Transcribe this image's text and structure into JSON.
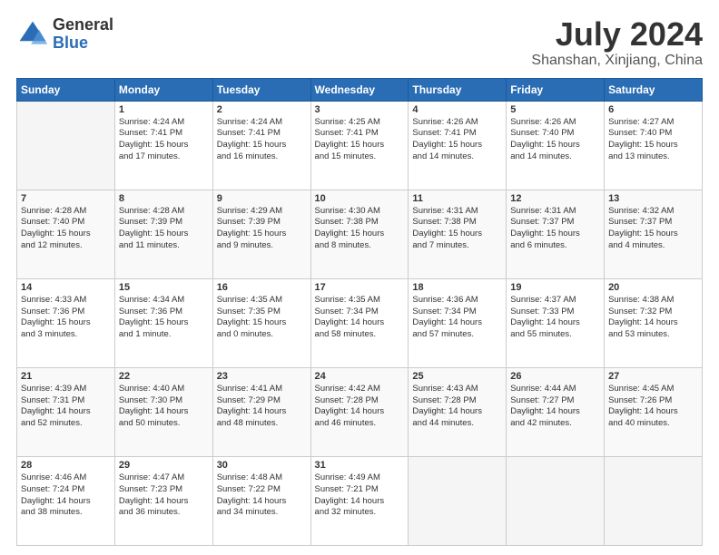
{
  "header": {
    "logo_general": "General",
    "logo_blue": "Blue",
    "title": "July 2024",
    "subtitle": "Shanshan, Xinjiang, China"
  },
  "days_of_week": [
    "Sunday",
    "Monday",
    "Tuesday",
    "Wednesday",
    "Thursday",
    "Friday",
    "Saturday"
  ],
  "weeks": [
    [
      {
        "day": "",
        "info": ""
      },
      {
        "day": "1",
        "info": "Sunrise: 4:24 AM\nSunset: 7:41 PM\nDaylight: 15 hours\nand 17 minutes."
      },
      {
        "day": "2",
        "info": "Sunrise: 4:24 AM\nSunset: 7:41 PM\nDaylight: 15 hours\nand 16 minutes."
      },
      {
        "day": "3",
        "info": "Sunrise: 4:25 AM\nSunset: 7:41 PM\nDaylight: 15 hours\nand 15 minutes."
      },
      {
        "day": "4",
        "info": "Sunrise: 4:26 AM\nSunset: 7:41 PM\nDaylight: 15 hours\nand 14 minutes."
      },
      {
        "day": "5",
        "info": "Sunrise: 4:26 AM\nSunset: 7:40 PM\nDaylight: 15 hours\nand 14 minutes."
      },
      {
        "day": "6",
        "info": "Sunrise: 4:27 AM\nSunset: 7:40 PM\nDaylight: 15 hours\nand 13 minutes."
      }
    ],
    [
      {
        "day": "7",
        "info": "Sunrise: 4:28 AM\nSunset: 7:40 PM\nDaylight: 15 hours\nand 12 minutes."
      },
      {
        "day": "8",
        "info": "Sunrise: 4:28 AM\nSunset: 7:39 PM\nDaylight: 15 hours\nand 11 minutes."
      },
      {
        "day": "9",
        "info": "Sunrise: 4:29 AM\nSunset: 7:39 PM\nDaylight: 15 hours\nand 9 minutes."
      },
      {
        "day": "10",
        "info": "Sunrise: 4:30 AM\nSunset: 7:38 PM\nDaylight: 15 hours\nand 8 minutes."
      },
      {
        "day": "11",
        "info": "Sunrise: 4:31 AM\nSunset: 7:38 PM\nDaylight: 15 hours\nand 7 minutes."
      },
      {
        "day": "12",
        "info": "Sunrise: 4:31 AM\nSunset: 7:37 PM\nDaylight: 15 hours\nand 6 minutes."
      },
      {
        "day": "13",
        "info": "Sunrise: 4:32 AM\nSunset: 7:37 PM\nDaylight: 15 hours\nand 4 minutes."
      }
    ],
    [
      {
        "day": "14",
        "info": "Sunrise: 4:33 AM\nSunset: 7:36 PM\nDaylight: 15 hours\nand 3 minutes."
      },
      {
        "day": "15",
        "info": "Sunrise: 4:34 AM\nSunset: 7:36 PM\nDaylight: 15 hours\nand 1 minute."
      },
      {
        "day": "16",
        "info": "Sunrise: 4:35 AM\nSunset: 7:35 PM\nDaylight: 15 hours\nand 0 minutes."
      },
      {
        "day": "17",
        "info": "Sunrise: 4:35 AM\nSunset: 7:34 PM\nDaylight: 14 hours\nand 58 minutes."
      },
      {
        "day": "18",
        "info": "Sunrise: 4:36 AM\nSunset: 7:34 PM\nDaylight: 14 hours\nand 57 minutes."
      },
      {
        "day": "19",
        "info": "Sunrise: 4:37 AM\nSunset: 7:33 PM\nDaylight: 14 hours\nand 55 minutes."
      },
      {
        "day": "20",
        "info": "Sunrise: 4:38 AM\nSunset: 7:32 PM\nDaylight: 14 hours\nand 53 minutes."
      }
    ],
    [
      {
        "day": "21",
        "info": "Sunrise: 4:39 AM\nSunset: 7:31 PM\nDaylight: 14 hours\nand 52 minutes."
      },
      {
        "day": "22",
        "info": "Sunrise: 4:40 AM\nSunset: 7:30 PM\nDaylight: 14 hours\nand 50 minutes."
      },
      {
        "day": "23",
        "info": "Sunrise: 4:41 AM\nSunset: 7:29 PM\nDaylight: 14 hours\nand 48 minutes."
      },
      {
        "day": "24",
        "info": "Sunrise: 4:42 AM\nSunset: 7:28 PM\nDaylight: 14 hours\nand 46 minutes."
      },
      {
        "day": "25",
        "info": "Sunrise: 4:43 AM\nSunset: 7:28 PM\nDaylight: 14 hours\nand 44 minutes."
      },
      {
        "day": "26",
        "info": "Sunrise: 4:44 AM\nSunset: 7:27 PM\nDaylight: 14 hours\nand 42 minutes."
      },
      {
        "day": "27",
        "info": "Sunrise: 4:45 AM\nSunset: 7:26 PM\nDaylight: 14 hours\nand 40 minutes."
      }
    ],
    [
      {
        "day": "28",
        "info": "Sunrise: 4:46 AM\nSunset: 7:24 PM\nDaylight: 14 hours\nand 38 minutes."
      },
      {
        "day": "29",
        "info": "Sunrise: 4:47 AM\nSunset: 7:23 PM\nDaylight: 14 hours\nand 36 minutes."
      },
      {
        "day": "30",
        "info": "Sunrise: 4:48 AM\nSunset: 7:22 PM\nDaylight: 14 hours\nand 34 minutes."
      },
      {
        "day": "31",
        "info": "Sunrise: 4:49 AM\nSunset: 7:21 PM\nDaylight: 14 hours\nand 32 minutes."
      },
      {
        "day": "",
        "info": ""
      },
      {
        "day": "",
        "info": ""
      },
      {
        "day": "",
        "info": ""
      }
    ]
  ]
}
